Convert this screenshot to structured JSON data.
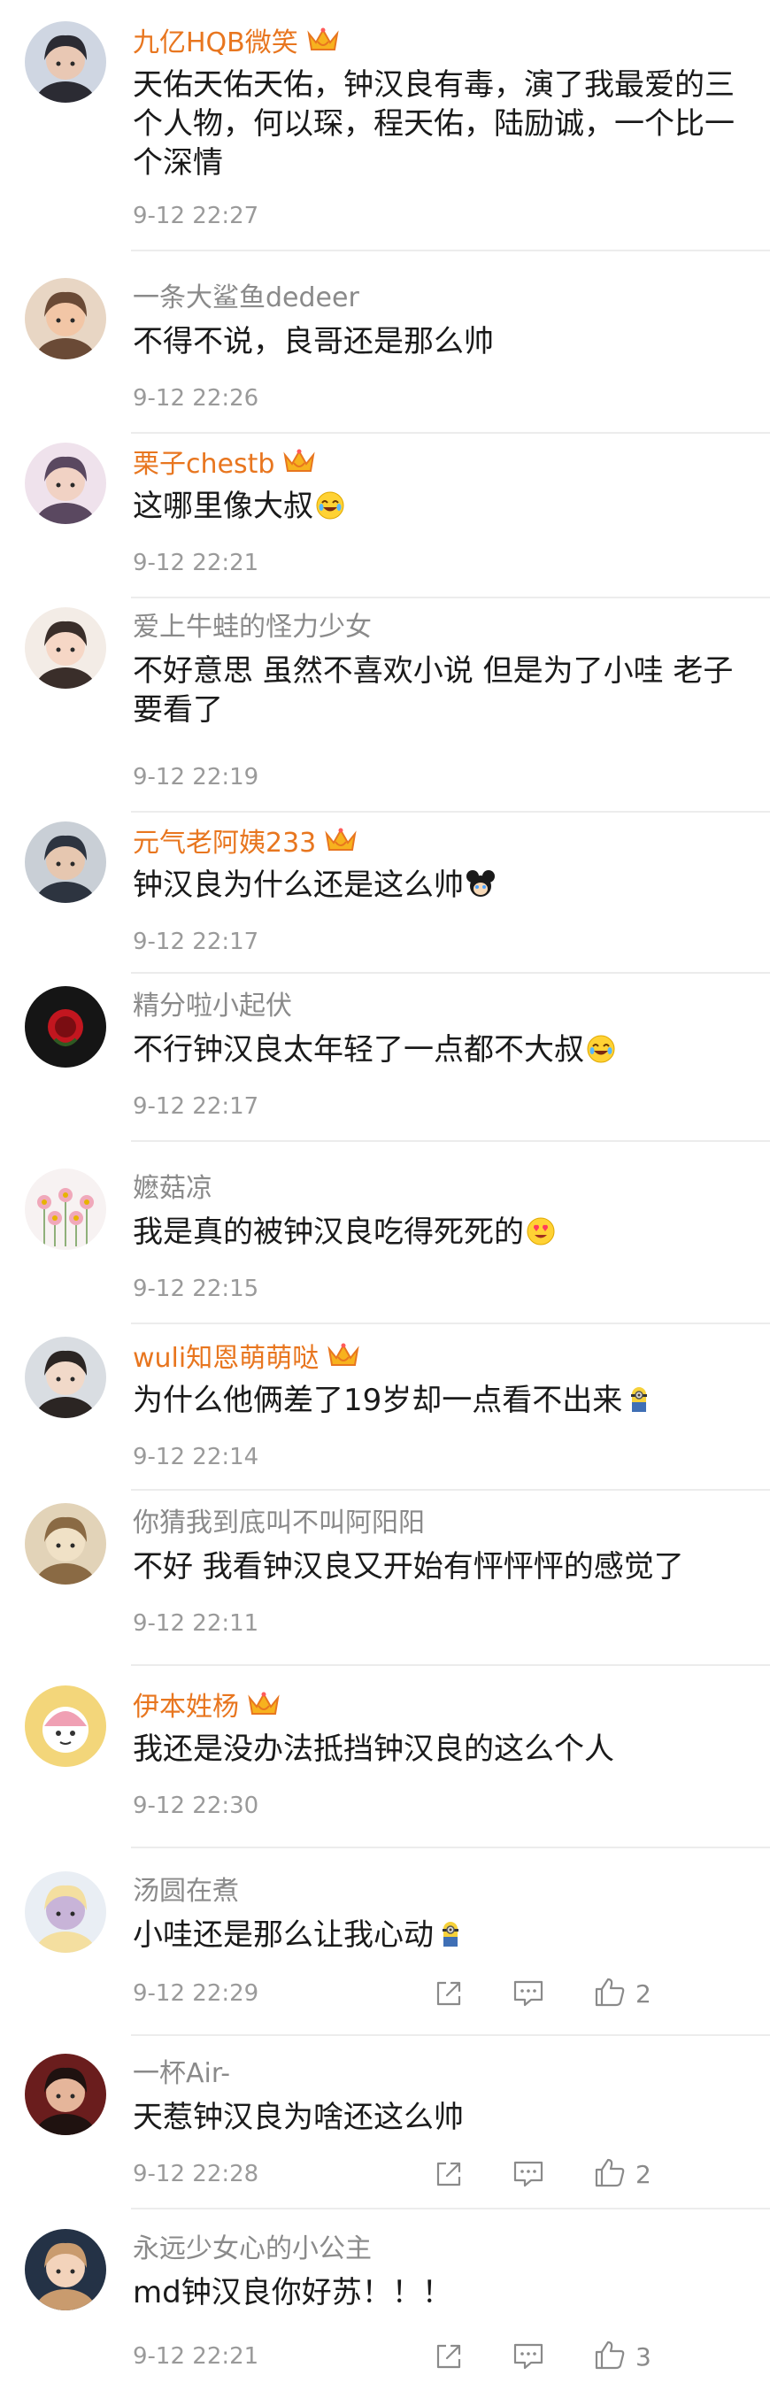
{
  "comments": [
    {
      "username": "九亿HQB微笑",
      "vip": true,
      "text": "天佑天佑天佑，钟汉良有毒，演了我最爱的三个人物，何以琛，程天佑，陆励诚，一个比一个深情",
      "time": "9-12 22:27"
    },
    {
      "username": "一条大鲨鱼dedeer",
      "vip": false,
      "text": "不得不说，良哥还是那么帅",
      "time": "9-12 22:26"
    },
    {
      "username": "栗子chestb",
      "vip": true,
      "text": "这哪里像大叔",
      "emoji": "laugh-cry-emoji",
      "time": "9-12 22:21"
    },
    {
      "username": "爱上牛蛙的怪力少女",
      "vip": false,
      "text": "不好意思 虽然不喜欢小说 但是为了小哇 老子要看了",
      "time": "9-12 22:19"
    },
    {
      "username": "元气老阿姨233",
      "vip": true,
      "text": "钟汉良为什么还是这么帅",
      "emoji": "mouse-crying-emoji",
      "time": "9-12 22:17"
    },
    {
      "username": "精分啦小起伏",
      "vip": false,
      "text": "不行钟汉良太年轻了一点都不大叔",
      "emoji": "laugh-cry-emoji",
      "time": "9-12 22:17"
    },
    {
      "username": "嬷菇凉",
      "vip": false,
      "text": "我是真的被钟汉良吃得死死的",
      "emoji": "heart-eyes-emoji",
      "time": "9-12 22:15"
    },
    {
      "username": "wuli知恩萌萌哒",
      "vip": true,
      "text": "为什么他俩差了19岁却一点看不出来",
      "emoji": "minion-emoji",
      "time": "9-12 22:14"
    },
    {
      "username": "你猜我到底叫不叫阿阳阳",
      "vip": false,
      "text": "不好  我看钟汉良又开始有怦怦怦的感觉了",
      "time": "9-12 22:11"
    },
    {
      "username": "伊本姓杨",
      "vip": true,
      "text": "我还是没办法抵挡钟汉良的这么个人",
      "time": "9-12 22:30"
    },
    {
      "username": "汤圆在煮",
      "vip": false,
      "text": "小哇还是那么让我心动",
      "emoji": "minion-emoji",
      "time": "9-12 22:29",
      "likes": "2"
    },
    {
      "username": "一杯Air-",
      "vip": false,
      "text": "天惹钟汉良为啥还这么帅",
      "time": "9-12 22:28",
      "likes": "2"
    },
    {
      "username": "永远少女心的小公主",
      "vip": false,
      "text": "md钟汉良你好苏！！！",
      "time": "9-12 22:21",
      "likes": "3"
    }
  ],
  "colors": {
    "vip_name": "#e8761f",
    "normal_name": "#8a8a8a",
    "text": "#1a1a1a",
    "time": "#9a9a9a",
    "divider": "#ececec",
    "icon": "#8a8a8a"
  },
  "icons": {
    "crown": "vip-crown-icon",
    "share": "share-icon",
    "comment": "comment-icon",
    "like": "thumbs-up-icon"
  }
}
